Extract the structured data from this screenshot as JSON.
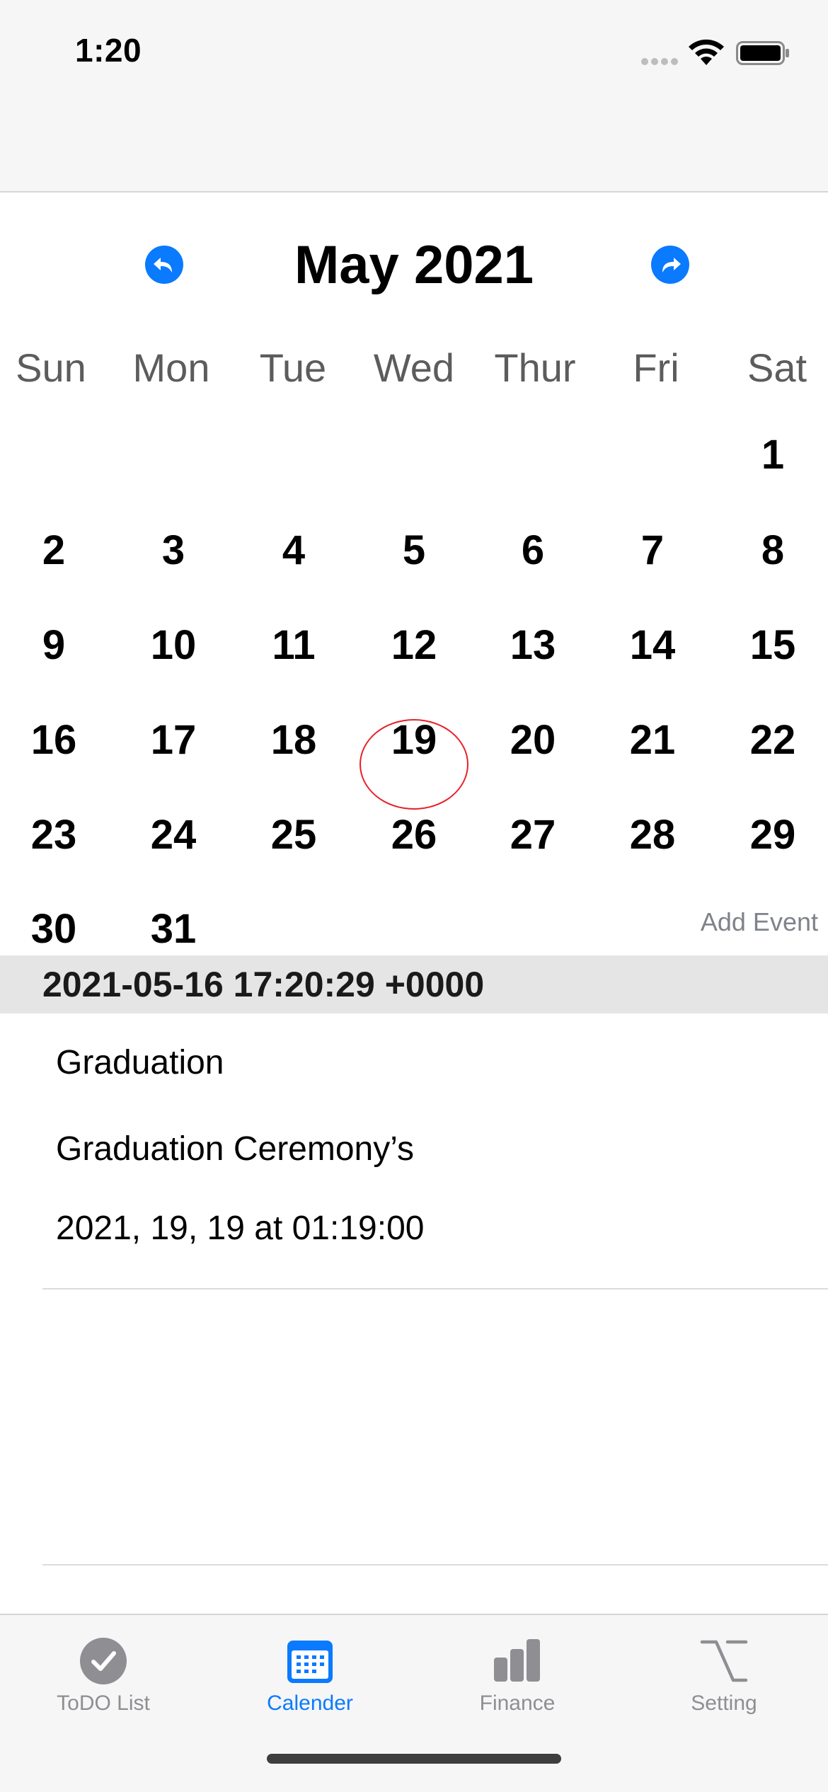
{
  "status_bar": {
    "time": "1:20"
  },
  "calendar": {
    "month_title": "May 2021",
    "weekdays": [
      "Sun",
      "Mon",
      "Tue",
      "Wed",
      "Thur",
      "Fri",
      "Sat"
    ],
    "days": [
      "1",
      "2",
      "3",
      "4",
      "5",
      "6",
      "7",
      "8",
      "9",
      "10",
      "11",
      "12",
      "13",
      "14",
      "15",
      "16",
      "17",
      "18",
      "19",
      "20",
      "21",
      "22",
      "23",
      "24",
      "25",
      "26",
      "27",
      "28",
      "29",
      "30",
      "31"
    ],
    "first_weekday_index": 6,
    "highlighted_day": "19",
    "add_event_label": "Add Event"
  },
  "events": {
    "section_header": "2021-05-16 17:20:29 +0000",
    "items": [
      {
        "title": "Graduation",
        "subtitle": "Graduation Ceremony’s",
        "time": "2021, 19, 19 at 01:19:00"
      }
    ]
  },
  "tab_bar": {
    "tabs": [
      {
        "label": "ToDO List",
        "icon": "checkmark-circle-icon"
      },
      {
        "label": "Calender",
        "icon": "calendar-icon"
      },
      {
        "label": "Finance",
        "icon": "bar-chart-icon"
      },
      {
        "label": "Setting",
        "icon": "option-key-icon"
      }
    ],
    "active_index": 1
  },
  "colors": {
    "accent": "#0a7aff",
    "today_ring": "#e8202a",
    "tab_inactive": "#8e8e93"
  }
}
